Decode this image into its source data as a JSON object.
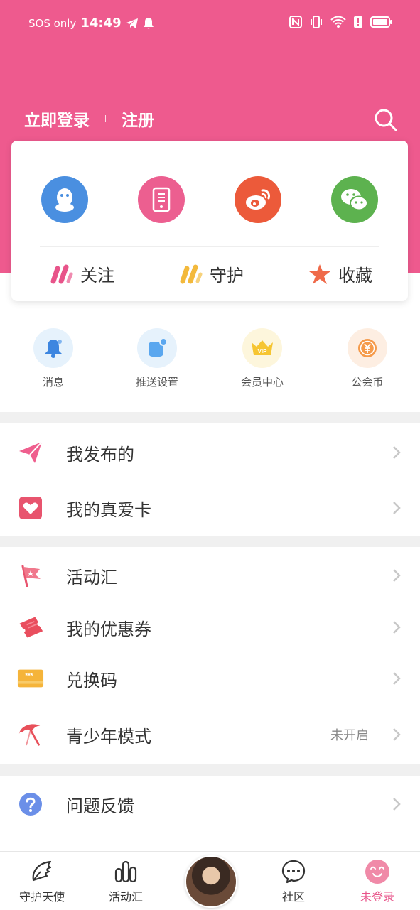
{
  "status": {
    "carrier": "SOS only",
    "time": "14:49"
  },
  "header": {
    "login": "立即登录",
    "register": "注册"
  },
  "stats": [
    {
      "label": "关注",
      "color": "#e8548a"
    },
    {
      "label": "守护",
      "color": "#f3b93c"
    },
    {
      "label": "收藏",
      "color": "#ef6a4a"
    }
  ],
  "social": [
    {
      "icon": "qq-icon",
      "color": "#4a8fe0"
    },
    {
      "icon": "phone-icon",
      "color": "#ec5f90"
    },
    {
      "icon": "weibo-icon",
      "color": "#ec5a3a"
    },
    {
      "icon": "wechat-icon",
      "color": "#5db24f"
    }
  ],
  "quick": [
    {
      "label": "消息",
      "icon": "bell-icon"
    },
    {
      "label": "推送设置",
      "icon": "push-settings-icon"
    },
    {
      "label": "会员中心",
      "icon": "vip-icon"
    },
    {
      "label": "公会币",
      "icon": "coin-icon"
    }
  ],
  "menu": {
    "section1": [
      {
        "label": "我发布的",
        "icon": "paper-plane-icon"
      },
      {
        "label": "我的真爱卡",
        "icon": "heart-card-icon"
      }
    ],
    "section2": [
      {
        "label": "活动汇",
        "icon": "flag-icon"
      },
      {
        "label": "我的优惠券",
        "icon": "ticket-icon"
      },
      {
        "label": "兑换码",
        "icon": "code-card-icon"
      },
      {
        "label": "青少年模式",
        "icon": "umbrella-icon",
        "value": "未开启"
      }
    ],
    "section3": [
      {
        "label": "问题反馈",
        "icon": "question-icon"
      }
    ]
  },
  "nav": [
    {
      "label": "守护天使",
      "icon": "wing-icon"
    },
    {
      "label": "活动汇",
      "icon": "bars-icon"
    },
    {
      "label": "",
      "icon": "avatar"
    },
    {
      "label": "社区",
      "icon": "chat-icon"
    },
    {
      "label": "未登录",
      "icon": "smiley-icon",
      "active": true
    }
  ],
  "colors": {
    "brand": "#ee5a8e",
    "active_nav": "#e8548a"
  }
}
